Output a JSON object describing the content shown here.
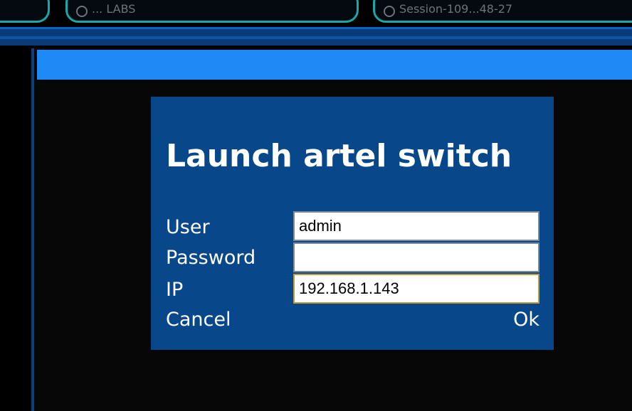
{
  "tabs": [
    {
      "label": "... LABS"
    },
    {
      "label": "Session-109...48-27"
    }
  ],
  "dialog": {
    "title": "Launch artel switch",
    "fields": {
      "user": {
        "label": "User",
        "value": "admin"
      },
      "password": {
        "label": "Password",
        "value": ""
      },
      "ip": {
        "label": "IP",
        "value": "192.168.1.143"
      }
    },
    "cancel_label": "Cancel",
    "ok_label": "Ok"
  },
  "colors": {
    "dialog_bg": "#07478a",
    "accent_strip": "#1f8af5",
    "tab_border": "#19a7a7"
  }
}
